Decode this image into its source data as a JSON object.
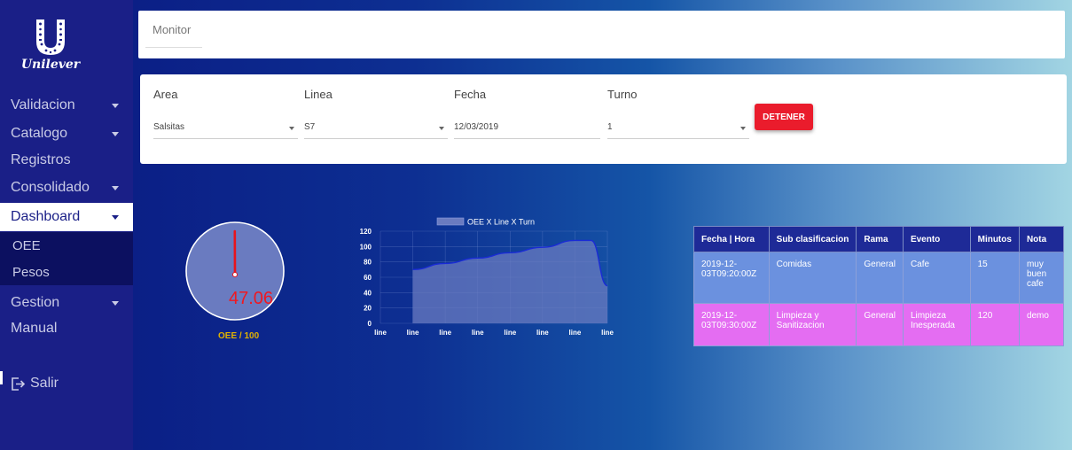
{
  "sidebar": {
    "logo_text": "Unilever",
    "items": [
      {
        "label": "Validacion",
        "has_caret": true
      },
      {
        "label": "Catalogo",
        "has_caret": true
      },
      {
        "label": "Registros",
        "has_caret": false
      },
      {
        "label": "Consolidado",
        "has_caret": true
      },
      {
        "label": "Dashboard",
        "has_caret": true,
        "active": true
      },
      {
        "label": "Gestion",
        "has_caret": true
      },
      {
        "label": "Manual",
        "has_caret": false
      }
    ],
    "sub_items": [
      {
        "label": "OEE"
      },
      {
        "label": "Pesos"
      }
    ],
    "exit": {
      "label": "Salir",
      "icon": "exit-icon"
    }
  },
  "header": {
    "title": "Monitor"
  },
  "filters": {
    "area": {
      "label": "Area",
      "value": "Salsitas"
    },
    "linea": {
      "label": "Linea",
      "value": "S7"
    },
    "fecha": {
      "label": "Fecha",
      "value": "12/03/2019"
    },
    "turno": {
      "label": "Turno",
      "value": "1"
    },
    "stop_label": "DETENER"
  },
  "gauge": {
    "value_text": "47.06",
    "value": 47.06,
    "max": 100,
    "label": "OEE / 100"
  },
  "chart_data": {
    "type": "area",
    "legend": "OEE X Line X Turn",
    "categories": [
      "line",
      "line",
      "line",
      "line",
      "line",
      "line",
      "line",
      "line"
    ],
    "yticks": [
      0,
      20,
      40,
      60,
      80,
      100,
      120
    ],
    "ylim": [
      0,
      120
    ],
    "series": [
      {
        "name": "OEE X Line X Turn",
        "points": [
          [
            1,
            70
          ],
          [
            2,
            78
          ],
          [
            3,
            85
          ],
          [
            4,
            92
          ],
          [
            5,
            99
          ],
          [
            6,
            108
          ],
          [
            6.5,
            108
          ],
          [
            7,
            49
          ]
        ]
      }
    ],
    "grid": true,
    "legend_position": "top"
  },
  "table": {
    "headers": [
      "Fecha | Hora",
      "Sub clasificacion",
      "Rama",
      "Evento",
      "Minutos",
      "Nota"
    ],
    "rows": [
      {
        "fecha": "2019-12-03T09:20:00Z",
        "sub": "Comidas",
        "rama": "General",
        "evento": "Cafe",
        "minutos": "15",
        "nota": "muy buen cafe"
      },
      {
        "fecha": "2019-12-03T09:30:00Z",
        "sub": "Limpieza y Sanitizacion",
        "rama": "General",
        "evento": "Limpieza Inesperada",
        "minutos": "120",
        "nota": "demo"
      }
    ]
  },
  "colors": {
    "sidebar": "#1a1f87",
    "accent_red": "#ea1c2c",
    "gauge_fill": "#6a7bc0",
    "row_blue": "#6b91df",
    "row_pink": "#e46df2"
  }
}
